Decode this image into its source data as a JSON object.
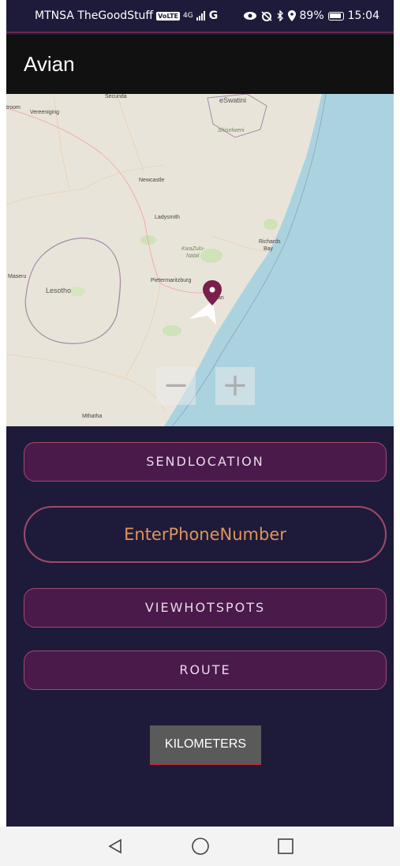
{
  "status_bar": {
    "carrier": "MTNSA TheGoodStuff",
    "volte": "VoLTE",
    "network_type": "4G",
    "signal_glyph": "G",
    "battery": "89%",
    "time": "15:04",
    "icons": [
      "eye-icon",
      "alarm-icon",
      "bluetooth-icon",
      "location-icon",
      "battery-icon"
    ]
  },
  "app_bar": {
    "title": "Avian"
  },
  "map": {
    "labels": {
      "secunda": "Secunda",
      "eswatini": "eSwatini",
      "shiselweni": "Shiselweni",
      "troom": "troom",
      "vereeniging": "Vereeniging",
      "newcastle": "Newcastle",
      "ladysmith": "Ladysmith",
      "kwazulu": "KwaZulu-",
      "natal": "Natal",
      "richards": "Richards",
      "bay": "Bay",
      "maseru": "Maseru",
      "lesotho": "Lesotho",
      "pietermaritzburg": "Pietermaritzburg",
      "durban_fragment": "an",
      "mthatha": "Mthatha"
    },
    "zoom_out": "−",
    "zoom_in": "+",
    "colors": {
      "land": "#e9e4d9",
      "water": "#aad3df",
      "marker": "#7a1f4a"
    }
  },
  "buttons": {
    "send_location": "SENDLOCATION",
    "view_hotspots": "VIEWHOTSPOTS",
    "route": "ROUTE",
    "kilometers": "KILOMETERS"
  },
  "phone_input": {
    "placeholder": "EnterPhoneNumber",
    "value": ""
  }
}
